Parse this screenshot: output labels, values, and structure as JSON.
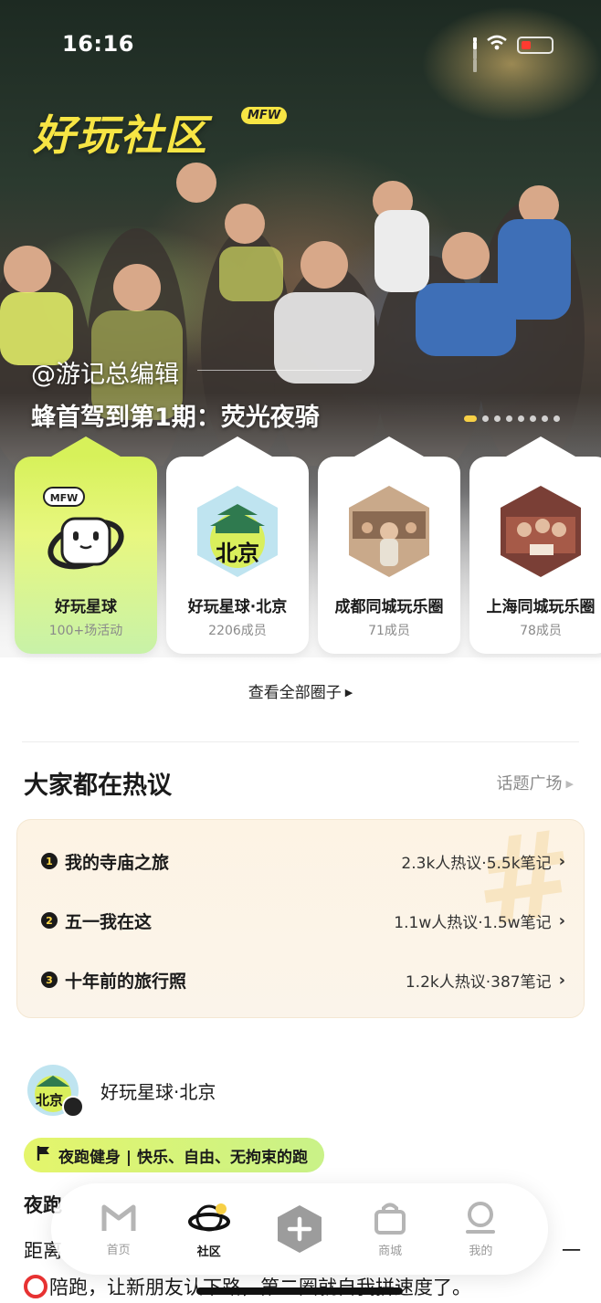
{
  "status_bar": {
    "time": "16:16"
  },
  "hero": {
    "brand_title": "好玩社区",
    "brand_badge": "MFW",
    "author": "@游记总编辑",
    "title": "蜂首驾到第1期：荧光夜骑",
    "slide_count": 8,
    "active_slide": 1
  },
  "circles": [
    {
      "name": "好玩星球",
      "sub": "100+场活动",
      "badge": "MFW"
    },
    {
      "name": "好玩星球·北京",
      "sub": "2206成员",
      "img_text": "北京"
    },
    {
      "name": "成都同城玩乐圈",
      "sub": "71成员"
    },
    {
      "name": "上海同城玩乐圈",
      "sub": "78成员"
    }
  ],
  "view_all_label": "查看全部圈子",
  "hot": {
    "title": "大家都在热议",
    "link": "话题广场",
    "topics": [
      {
        "rank": "1",
        "name": "我的寺庙之旅",
        "stats": "2.3k人热议·5.5k笔记"
      },
      {
        "rank": "2",
        "name": "五一我在这",
        "stats": "1.1w人热议·1.5w笔记"
      },
      {
        "rank": "3",
        "name": "十年前的旅行照",
        "stats": "1.2k人热议·387笔记"
      }
    ]
  },
  "post": {
    "circle_name": "好玩星球·北京",
    "avatar_text": "北京",
    "tag": "夜跑健身 | 快乐、自由、无拘束的跑",
    "head": "夜跑",
    "body_line1": "距离",
    "body_line1_end": "一",
    "body_line2": "陪跑，让新朋友认下路，第二圈就自我拼速度了。"
  },
  "tabbar": {
    "tabs": [
      {
        "label": "首页",
        "icon": "home-m-icon"
      },
      {
        "label": "社区",
        "icon": "planet-icon",
        "active": true
      },
      {
        "label": "",
        "icon": "plus-icon"
      },
      {
        "label": "商城",
        "icon": "shopping-bag-icon"
      },
      {
        "label": "我的",
        "icon": "profile-icon"
      }
    ]
  },
  "colors": {
    "accent_yellow": "#f7e544",
    "lime": "#d7f15a",
    "topic_bg": "#fdf3e4"
  }
}
